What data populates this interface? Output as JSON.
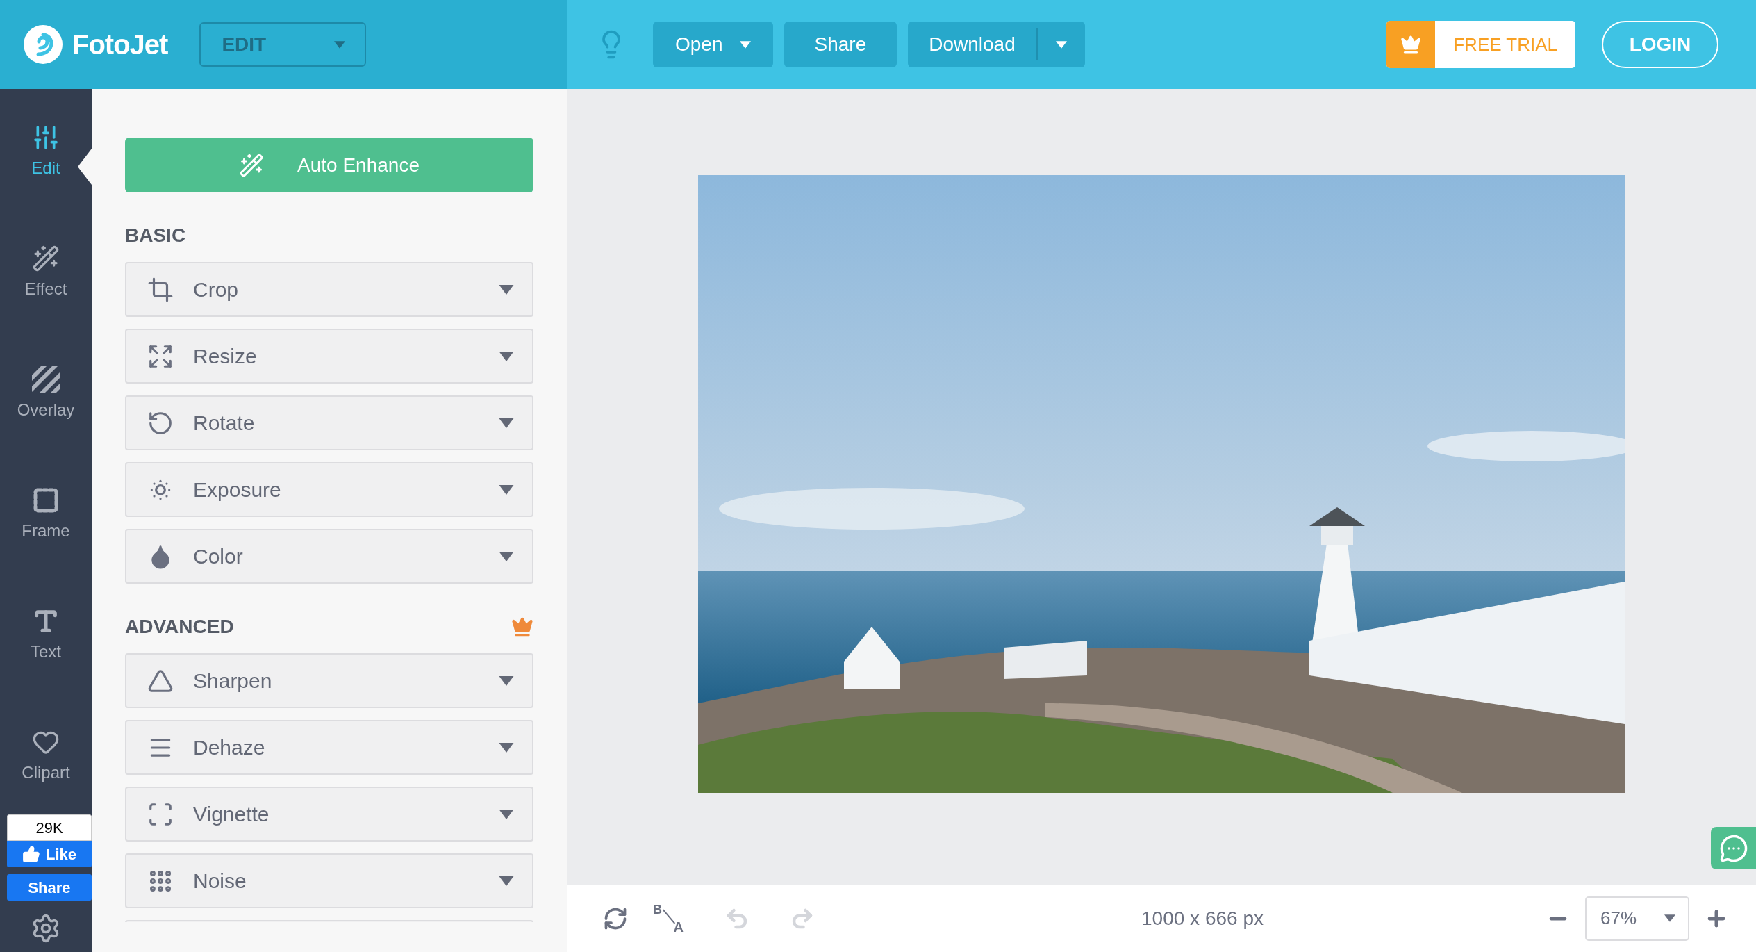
{
  "header": {
    "logo": "FotoJet",
    "mode_select": "EDIT",
    "buttons": [
      {
        "label": "Open",
        "kind": "menu"
      },
      {
        "label": "Share",
        "kind": "plain"
      },
      {
        "label": "Download",
        "kind": "split"
      }
    ],
    "free_trial": "FREE TRIAL",
    "login": "LOGIN"
  },
  "rail": {
    "items": [
      {
        "label": "Edit",
        "kind": "sliders",
        "selected": true
      },
      {
        "label": "Effect",
        "kind": "wand",
        "selected": false
      },
      {
        "label": "Overlay",
        "kind": "stripes",
        "selected": false
      },
      {
        "label": "Frame",
        "kind": "frame",
        "selected": false
      },
      {
        "label": "Text",
        "kind": "text",
        "selected": false
      },
      {
        "label": "Clipart",
        "kind": "heart",
        "selected": false
      }
    ],
    "like_count": "29K",
    "like": "Like",
    "share": "Share"
  },
  "panel": {
    "auto_enhance": "Auto Enhance",
    "sections": [
      {
        "title": "BASIC",
        "premium": false,
        "items": [
          {
            "label": "Crop",
            "kind": "crop"
          },
          {
            "label": "Resize",
            "kind": "resize"
          },
          {
            "label": "Rotate",
            "kind": "rotate"
          },
          {
            "label": "Exposure",
            "kind": "exposure"
          },
          {
            "label": "Color",
            "kind": "color"
          }
        ]
      },
      {
        "title": "ADVANCED",
        "premium": true,
        "items": [
          {
            "label": "Sharpen",
            "kind": "sharpen"
          },
          {
            "label": "Dehaze",
            "kind": "dehaze"
          },
          {
            "label": "Vignette",
            "kind": "vignette"
          },
          {
            "label": "Noise",
            "kind": "noise"
          }
        ]
      }
    ]
  },
  "bottom_bar": {
    "before_after": {
      "top": "B",
      "bottom": "A"
    },
    "undo_disabled": true,
    "redo_disabled": true,
    "dimensions": "1000 x 666 px",
    "zoom": "67%"
  }
}
